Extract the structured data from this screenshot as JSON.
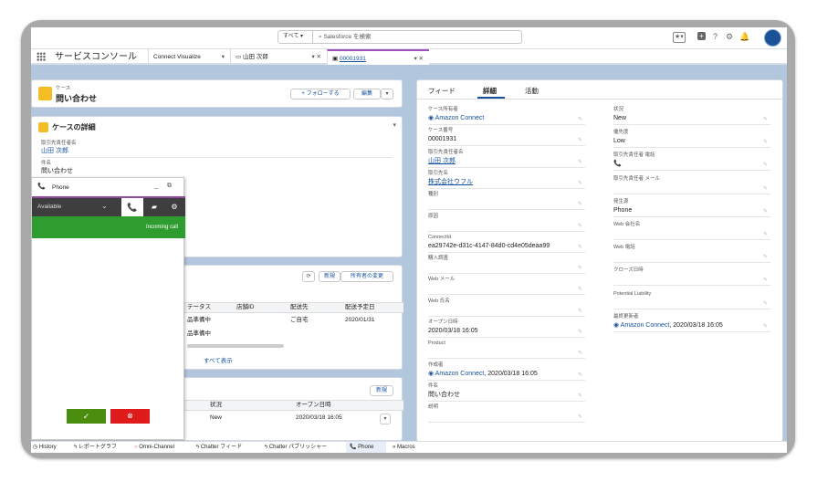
{
  "header": {
    "search_scope": "すべて",
    "search_placeholder": "Salesforce を検索",
    "icons": [
      "favorites-star-icon",
      "add-icon",
      "help-icon",
      "setup-gear-icon",
      "notification-bell-icon"
    ]
  },
  "nav": {
    "app_name": "サービスコンソール",
    "tabs": [
      {
        "label": "Connect Visualize"
      },
      {
        "label": "山田 次郎"
      },
      {
        "label": "00001931"
      }
    ]
  },
  "case_header": {
    "label": "ケース",
    "title": "問い合わせ",
    "follow": "+ フォローする",
    "edit": "編集"
  },
  "case_detail": {
    "title": "ケースの詳細",
    "fields": [
      {
        "label": "取引先責任者名",
        "value": "山田 次郎"
      },
      {
        "label": "件名",
        "value": "問い合わせ"
      }
    ]
  },
  "related": {
    "new_btn": "新規",
    "owner_btn": "所有者の変更",
    "columns": [
      "テータス",
      "店舗ID",
      "配送先",
      "配送予定日"
    ],
    "rows": [
      [
        "品準備中",
        "",
        "ご自宅",
        "2020/01/31"
      ],
      [
        "品準備中",
        "",
        "",
        ""
      ]
    ],
    "view_all": "すべて表示"
  },
  "cases_list": {
    "new_btn": "新規",
    "columns": [
      "状況",
      "オープン日時"
    ],
    "rows": [
      [
        "New",
        "2020/03/18 16:05"
      ]
    ]
  },
  "phone": {
    "title": "Phone",
    "status": "Available",
    "incoming": "Incoming call"
  },
  "detail": {
    "tabs": [
      "フィード",
      "詳細",
      "活動"
    ],
    "active_tab": "詳細",
    "left": [
      {
        "label": "ケース所有者",
        "value": "Amazon Connect"
      },
      {
        "label": "ケース番号",
        "value": "00001931"
      },
      {
        "label": "取引先責任者名",
        "value": "山田 次郎"
      },
      {
        "label": "取引先名",
        "value": "株式会社ウフル"
      },
      {
        "label": "種別",
        "value": ""
      },
      {
        "label": "原因",
        "value": ""
      },
      {
        "label": "ConnectId",
        "value": "ea29742e-d31c-4147-84d0-cd4e05deaa99"
      },
      {
        "label": "購入調査",
        "value": ""
      },
      {
        "label": "Web メール",
        "value": ""
      },
      {
        "label": "Web 氏名",
        "value": ""
      },
      {
        "label": "オープン日時",
        "value": "2020/03/18 16:05"
      },
      {
        "label": "Product",
        "value": ""
      },
      {
        "label": "作成者",
        "value": "Amazon Connect",
        "suffix": ", 2020/03/18 16:05"
      },
      {
        "label": "件名",
        "value": "問い合わせ"
      },
      {
        "label": "説明",
        "value": ""
      }
    ],
    "right": [
      {
        "label": "状況",
        "value": "New"
      },
      {
        "label": "優先度",
        "value": "Low"
      },
      {
        "label": "取引先責任者 電話",
        "value": ""
      },
      {
        "label": "取引先責任者 メール",
        "value": ""
      },
      {
        "label": "発生源",
        "value": "Phone"
      },
      {
        "label": "Web 会社名",
        "value": ""
      },
      {
        "label": "Web 電話",
        "value": ""
      },
      {
        "label": "クローズ日時",
        "value": ""
      },
      {
        "label": "Potential Liability",
        "value": ""
      },
      {
        "label": "最終更新者",
        "value": "Amazon Connect",
        "suffix": ", 2020/03/18 16:05"
      }
    ]
  },
  "utility": [
    {
      "label": "History"
    },
    {
      "label": "レポートグラフ"
    },
    {
      "label": "Omni-Channel"
    },
    {
      "label": "Chatter フィード"
    },
    {
      "label": "Chatter パブリッシャー"
    },
    {
      "label": "Phone"
    },
    {
      "label": "Macros"
    }
  ],
  "colors": {
    "brand": "#15519f",
    "incoming": "#2e9c2e",
    "accept": "#4b8d0e",
    "decline": "#e01b1b",
    "case_icon": "#f4bc25",
    "tab_accent": "#9e4fb8"
  }
}
